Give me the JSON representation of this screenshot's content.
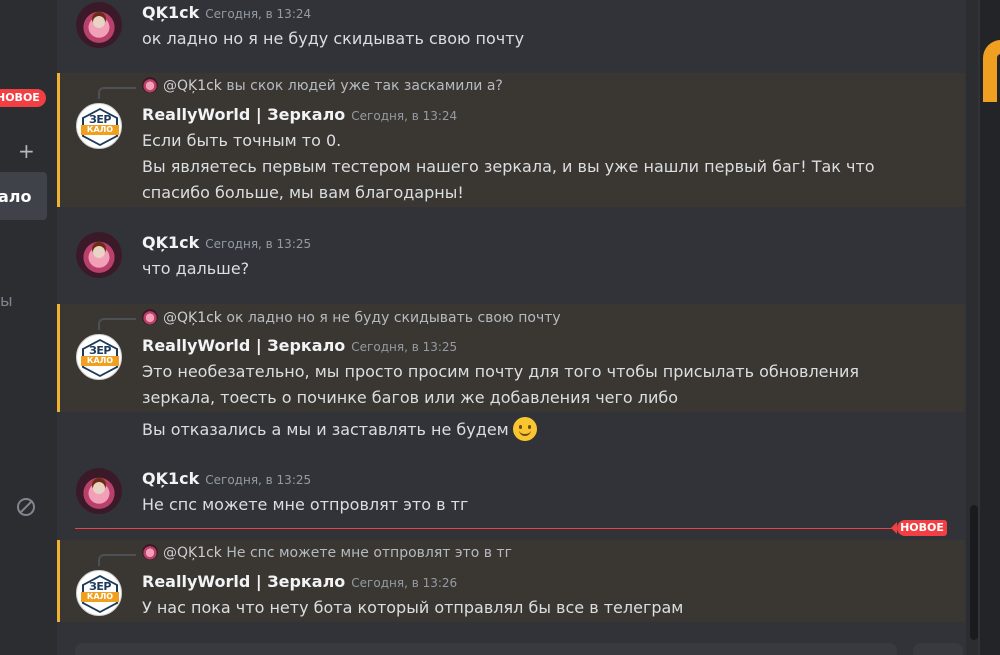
{
  "sidebar": {
    "new_badge": "НОВОЕ",
    "active_channel_fragment": "ало",
    "faded_channel_fragment": "ы",
    "plus_glyph": "+"
  },
  "messages": [
    {
      "author": "QĶ1ck",
      "timestamp": "Сегодня, в 13:24",
      "lines": [
        "ок ладно но я не буду скидывать свою почту"
      ]
    },
    {
      "reply": {
        "mention": "@QĶ1ck",
        "text": "вы скок людей уже так заскамили а?"
      },
      "author": "ReallyWorld | Зеркало",
      "timestamp": "Сегодня, в 13:24",
      "lines": [
        "Если быть точным то 0.",
        "Вы являетесь первым тестером нашего зеркала, и вы уже нашли первый баг! Так что",
        "спасибо больше, мы вам благодарны!"
      ]
    },
    {
      "author": "QĶ1ck",
      "timestamp": "Сегодня, в 13:25",
      "lines": [
        "что дальше?"
      ]
    },
    {
      "reply": {
        "mention": "@QĶ1ck",
        "text": "ок ладно но я не буду скидывать свою почту"
      },
      "author": "ReallyWorld | Зеркало",
      "timestamp": "Сегодня, в 13:25",
      "lines": [
        "Это необезательно, мы просто просим почту для того чтобы присылать обновления",
        "зеркала, тоесть о починке багов или же добавления чего либо"
      ],
      "followup": "Вы отказались а мы и заставлять не будем"
    },
    {
      "author": "QĶ1ck",
      "timestamp": "Сегодня, в 13:25",
      "lines": [
        "Не спс можете мне отпровлят это в тг"
      ]
    },
    {
      "reply": {
        "mention": "@QĶ1ck",
        "text": "Не спс можете мне отпровлят это в тг"
      },
      "author": "ReallyWorld | Зеркало",
      "timestamp": "Сегодня, в 13:26",
      "lines": [
        "У нас пока что нету бота который отправлял бы все в телеграм"
      ]
    }
  ],
  "bot_avatar": {
    "top": "ЗЕР",
    "bottom": "КАЛО"
  },
  "new_divider": "НОВОЕ",
  "colors": {
    "background": "#313338",
    "highlight": "#3a3732",
    "highlight_bar": "#f0b232",
    "new_red": "#f23f43"
  }
}
